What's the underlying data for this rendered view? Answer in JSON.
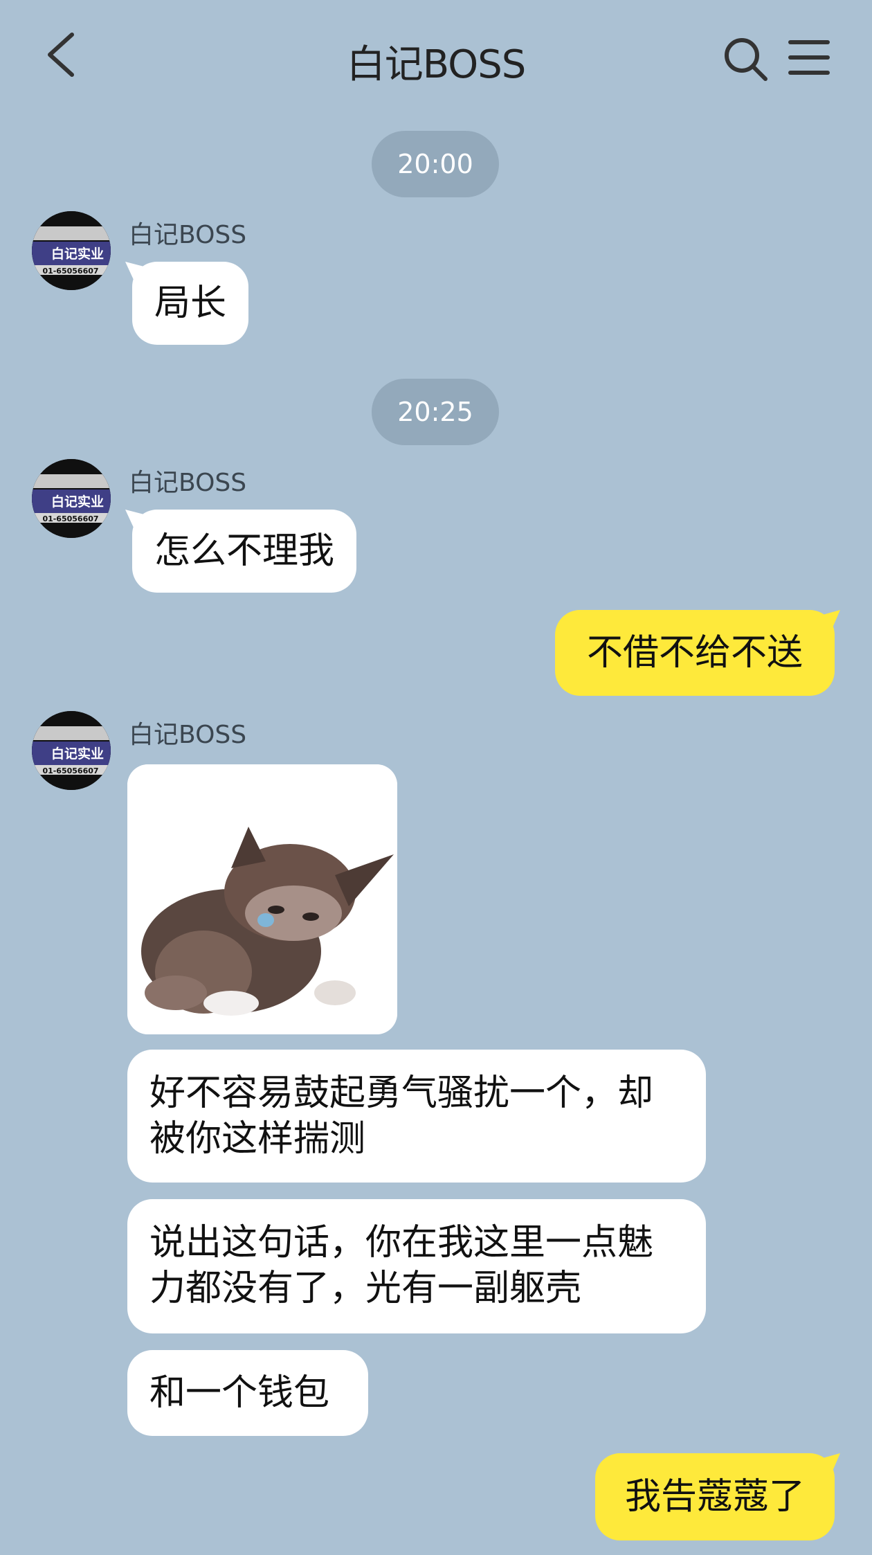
{
  "header": {
    "title": "白记BOSS"
  },
  "avatar_text": {
    "company": "白记实业",
    "phone": "01-65056607"
  },
  "messages": {
    "time1": "20:00",
    "m1_sender": "白记BOSS",
    "m1_text": "局长",
    "time2": "20:25",
    "m2_sender": "白记BOSS",
    "m2_text": "怎么不理我",
    "m3_text": "不借不给不送",
    "m4_sender": "白记BOSS",
    "m5_text": "好不容易鼓起勇气骚扰一个，却被你这样揣测",
    "m6_text": "说出这句话，你在我这里一点魅力都没有了，光有一副躯壳",
    "m7_text": "和一个钱包",
    "m8_text": "我告蔻蔻了"
  },
  "colors": {
    "background": "#abc1d3",
    "my_bubble": "#fee93b",
    "their_bubble": "#ffffff",
    "time_pill": "#93a9bb"
  },
  "icons": [
    "back-arrow-icon",
    "search-icon",
    "menu-icon",
    "kitten-sticker"
  ]
}
